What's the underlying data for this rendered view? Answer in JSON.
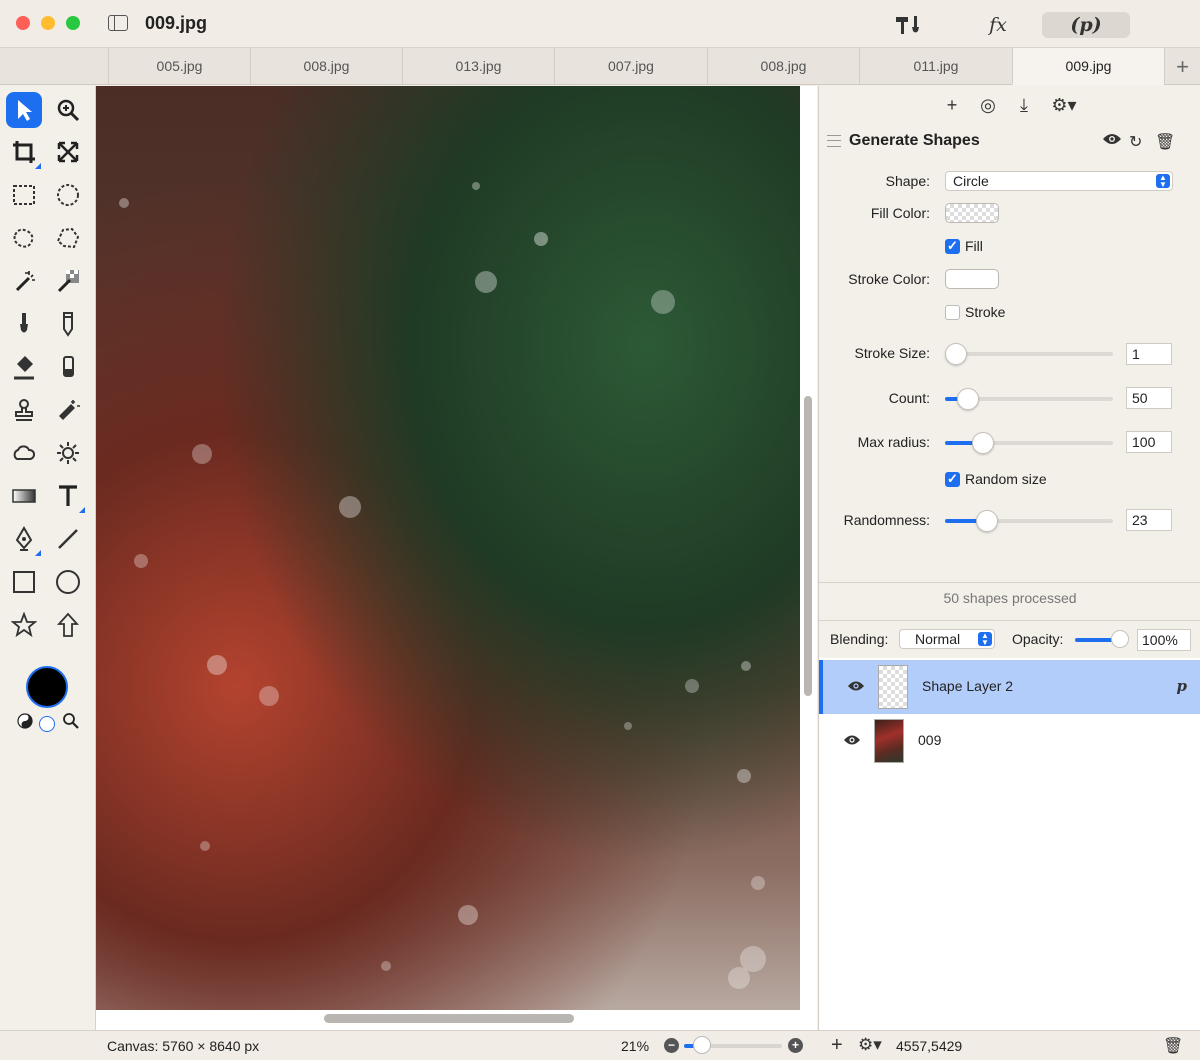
{
  "window": {
    "title": "009.jpg"
  },
  "toolbar": {
    "tools_icon": "hammer-brush-icon",
    "fx_label": "fx",
    "plugin_label": "(p)"
  },
  "tabs": [
    {
      "label": "005.jpg",
      "active": false
    },
    {
      "label": "008.jpg",
      "active": false
    },
    {
      "label": "013.jpg",
      "active": false
    },
    {
      "label": "007.jpg",
      "active": false
    },
    {
      "label": "008.jpg",
      "active": false
    },
    {
      "label": "011.jpg",
      "active": false
    },
    {
      "label": "009.jpg",
      "active": true
    }
  ],
  "tab_add_label": "+",
  "tools": [
    "arrow-select-icon",
    "zoom-icon",
    "crop-icon",
    "transform-icon",
    "rect-select-icon",
    "ellipse-select-icon",
    "lasso-icon",
    "polygon-lasso-icon",
    "magic-wand-icon",
    "color-select-icon",
    "brush-icon",
    "pencil-icon",
    "fill-icon",
    "eraser-icon",
    "clone-stamp-icon",
    "heal-icon",
    "cloud-icon",
    "sun-icon",
    "gradient-icon",
    "text-tool-icon",
    "pen-icon",
    "line-icon",
    "rectangle-shape-icon",
    "ellipse-shape-icon",
    "star-shape-icon",
    "arrow-shape-icon"
  ],
  "colors": {
    "foreground": "#000000",
    "background": "#ffffff",
    "accent": "#1e6ff0"
  },
  "panel": {
    "section_title": "Generate Shapes",
    "shape": {
      "label": "Shape:",
      "value": "Circle"
    },
    "fill_color": {
      "label": "Fill Color:"
    },
    "fill": {
      "label": "Fill",
      "checked": true
    },
    "stroke_color": {
      "label": "Stroke Color:",
      "value": "#ffffff"
    },
    "stroke": {
      "label": "Stroke",
      "checked": false
    },
    "stroke_size": {
      "label": "Stroke Size:",
      "value": "1"
    },
    "count": {
      "label": "Count:",
      "value": "50"
    },
    "max_radius": {
      "label": "Max radius:",
      "value": "100"
    },
    "random_size": {
      "label": "Random size",
      "checked": true
    },
    "randomness": {
      "label": "Randomness:",
      "value": "23"
    },
    "status": "50 shapes processed"
  },
  "layer_controls": {
    "blending_label": "Blending:",
    "blending_value": "Normal",
    "opacity_label": "Opacity:",
    "opacity_value": "100%"
  },
  "layers": [
    {
      "name": "Shape Layer 2",
      "selected": true,
      "badge": "p"
    },
    {
      "name": "009",
      "selected": false,
      "badge": ""
    }
  ],
  "statusbar": {
    "canvas_size": "Canvas: 5760 × 8640 px",
    "zoom": "21%",
    "coords": "4557,5429"
  }
}
